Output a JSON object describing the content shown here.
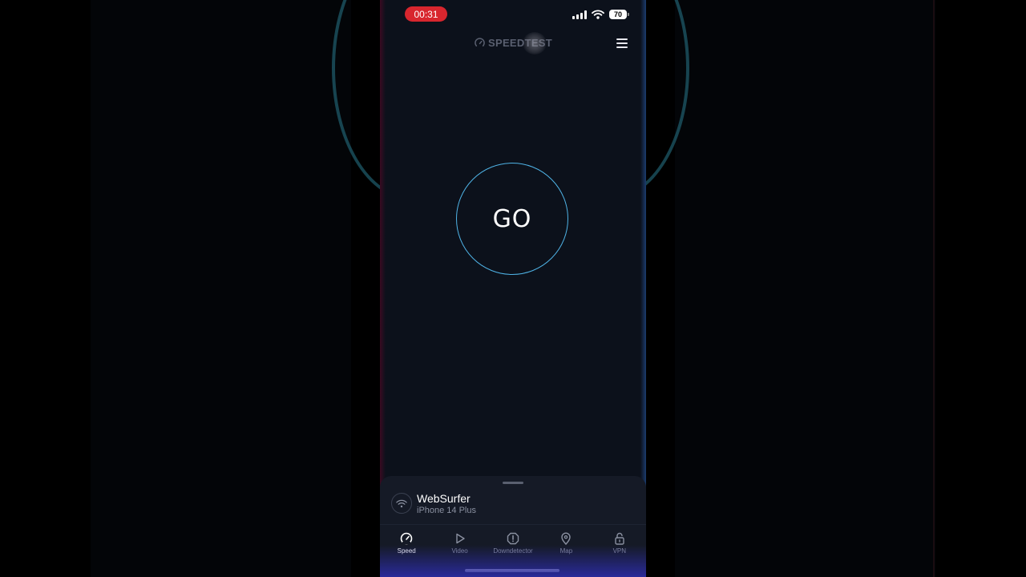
{
  "status_bar": {
    "recording_time": "00:31",
    "battery_level": "70"
  },
  "header": {
    "logo_text": "SPEEDTEST"
  },
  "main": {
    "go_label": "GO",
    "accent_color": "#4fb3e6"
  },
  "connection": {
    "name": "WebSurfer",
    "device": "iPhone 14 Plus"
  },
  "tabs": [
    {
      "label": "Speed",
      "icon": "speedometer-icon",
      "active": true
    },
    {
      "label": "Video",
      "icon": "play-icon",
      "active": false
    },
    {
      "label": "Downdetector",
      "icon": "alert-icon",
      "active": false
    },
    {
      "label": "Map",
      "icon": "map-pin-icon",
      "active": false
    },
    {
      "label": "VPN",
      "icon": "lock-icon",
      "active": false
    }
  ]
}
